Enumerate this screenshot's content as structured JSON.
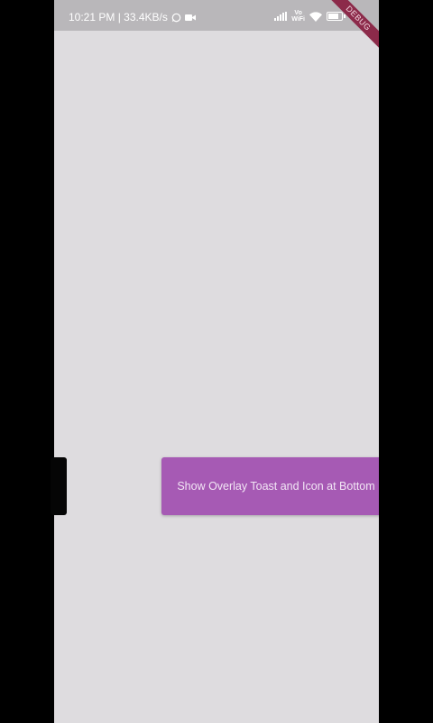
{
  "status_bar": {
    "time_speed": "10:21 PM | 33.4KB/s",
    "volte_line1": "Vo",
    "volte_line2": "WiFi",
    "icons": [
      "whatsapp-icon",
      "video-camera-icon",
      "signal-icon",
      "volte-icon",
      "wifi-icon",
      "battery-icon"
    ]
  },
  "debug_banner": {
    "label": "DEBUG"
  },
  "main": {
    "button_label": "Show Overlay Toast and Icon at Bottom"
  },
  "colors": {
    "background": "#dedcdf",
    "status_bar": "#b9b7ba",
    "button": "#a65ab4",
    "debug_banner": "#8c2a4a"
  }
}
